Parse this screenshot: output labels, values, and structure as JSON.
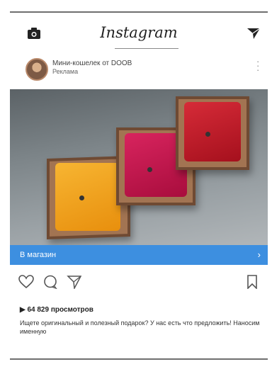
{
  "app": {
    "logo_text": "Instagram"
  },
  "post": {
    "account_name": "Мини-кошелек от DOOB",
    "sponsored_label": "Реклама",
    "shop_button_label": "В магазин",
    "views_text": "▶ 64 829 просмотров",
    "caption_text": "Ищете оригинальный и полезный подарок? У нас есть что предложить! Наносим именную"
  },
  "icons": {
    "camera": "camera-icon",
    "send": "direct-send-icon",
    "more": "more-options-icon",
    "heart": "heart-icon",
    "comment": "comment-icon",
    "share": "share-icon",
    "bookmark": "bookmark-icon",
    "chevron": "chevron-right-icon"
  },
  "colors": {
    "accent": "#3d8fe0",
    "wallet_orange": "#f2a21a",
    "wallet_pink": "#c3124d",
    "wallet_red": "#c0182a"
  }
}
